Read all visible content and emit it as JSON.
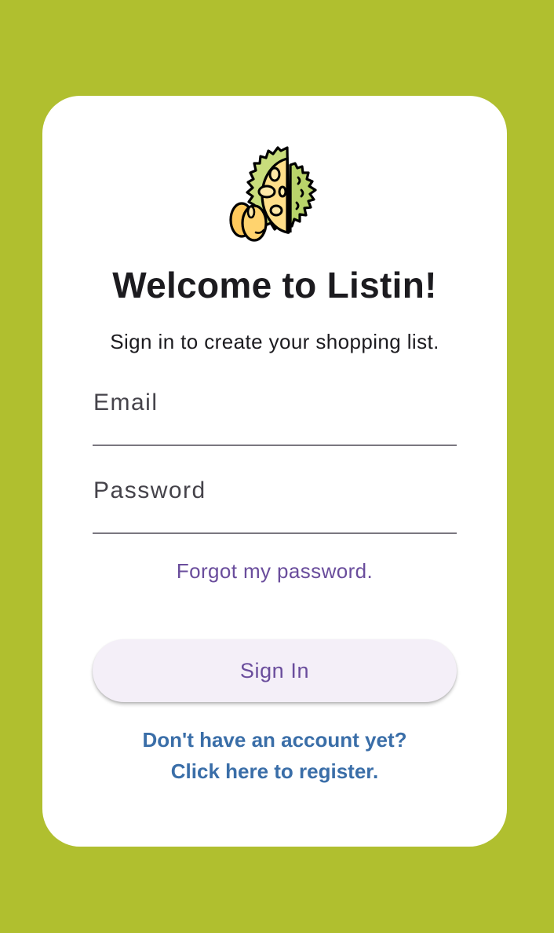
{
  "app": {
    "background_color": "#b0bf2f",
    "accent_color": "#6a4d9c",
    "link_color": "#3a6ea8"
  },
  "logo": {
    "icon": "durian-icon"
  },
  "header": {
    "title": "Welcome to Listin!",
    "subtitle": "Sign in to create your shopping list."
  },
  "form": {
    "email": {
      "label": "Email",
      "value": ""
    },
    "password": {
      "label": "Password",
      "value": ""
    },
    "forgot_label": "Forgot my password.",
    "signin_label": "Sign In"
  },
  "register": {
    "line1": "Don't have an account yet?",
    "line2": "Click here to register."
  }
}
